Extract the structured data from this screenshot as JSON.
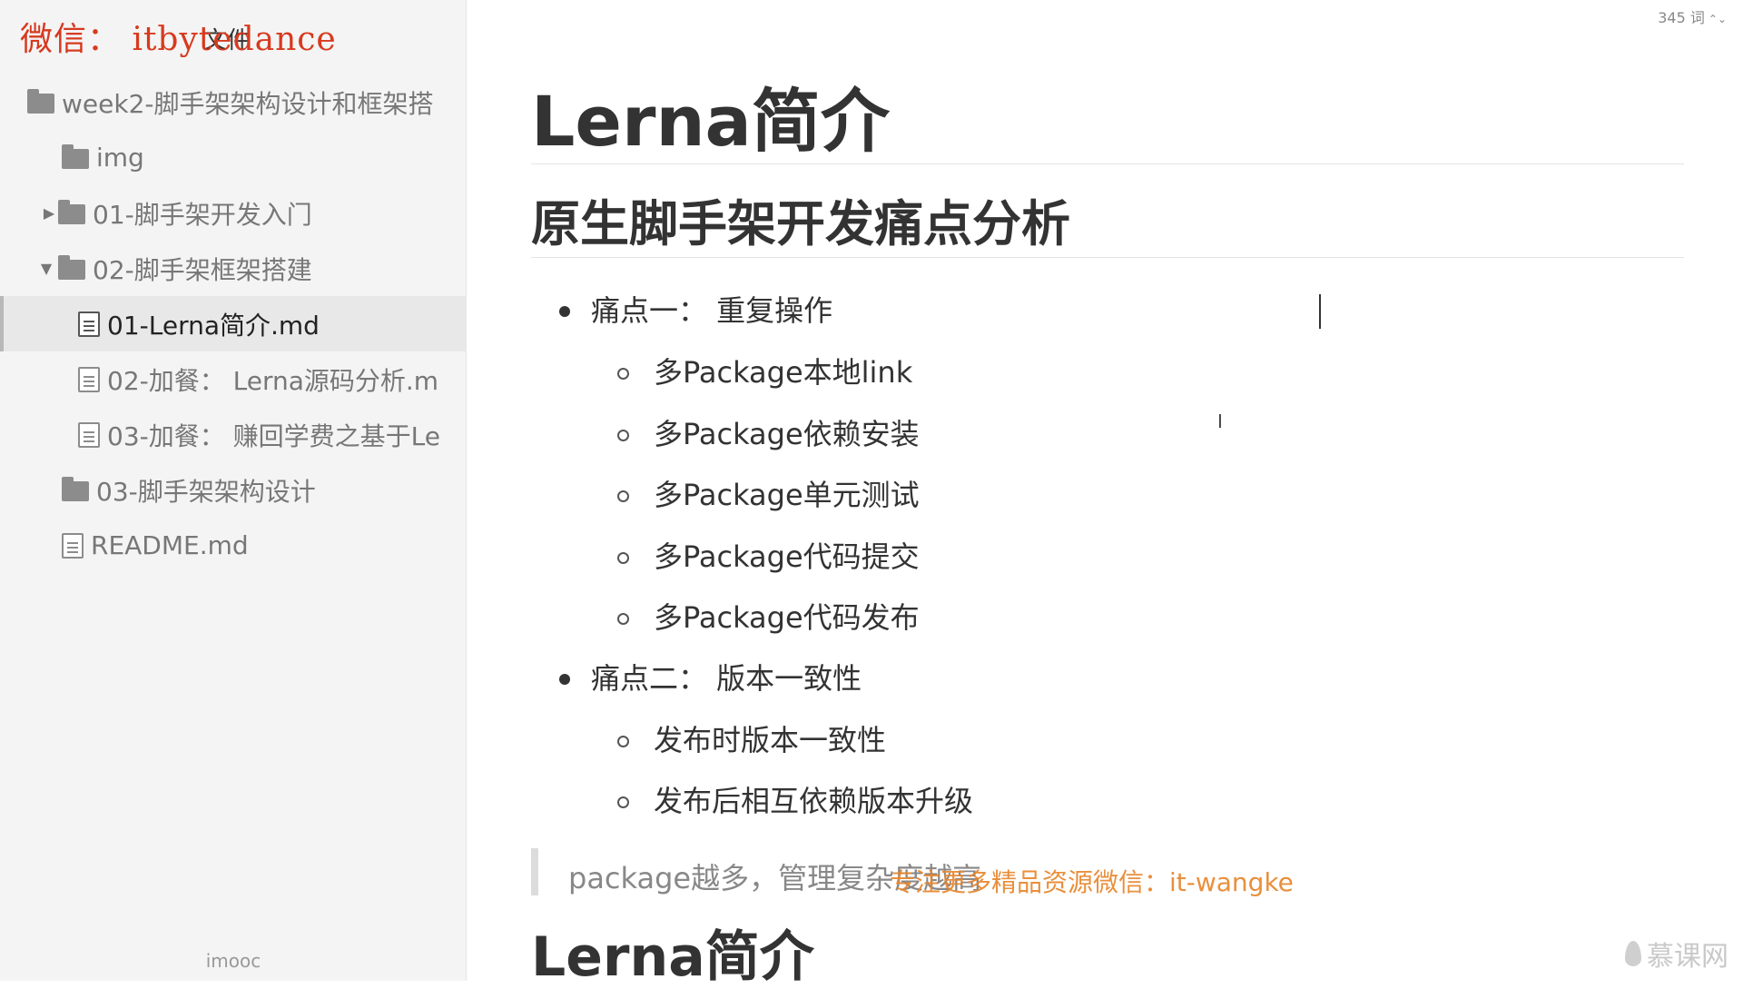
{
  "watermark_top_left": "微信： itbytedance",
  "sidebar": {
    "title": "文件",
    "items": [
      {
        "label": "week2-脚手架架构设计和框架搭",
        "type": "folder",
        "expander": "",
        "active": false
      },
      {
        "label": "img",
        "type": "folder",
        "expander": "",
        "active": false
      },
      {
        "label": "01-脚手架开发入门",
        "type": "folder",
        "expander": "▶",
        "active": false
      },
      {
        "label": "02-脚手架框架搭建",
        "type": "folder",
        "expander": "▼",
        "active": false
      },
      {
        "label": "01-Lerna简介.md",
        "type": "file",
        "expander": "",
        "active": true
      },
      {
        "label": "02-加餐：  Lerna源码分析.m",
        "type": "file",
        "expander": "",
        "active": false
      },
      {
        "label": "03-加餐：  赚回学费之基于Le",
        "type": "file",
        "expander": "",
        "active": false
      },
      {
        "label": "03-脚手架架构设计",
        "type": "folder",
        "expander": "",
        "active": false
      },
      {
        "label": "README.md",
        "type": "file",
        "expander": "",
        "active": false
      }
    ],
    "footer": "imooc"
  },
  "editor": {
    "word_count": "345 词",
    "h1": "Lerna简介",
    "h2": "原生脚手架开发痛点分析",
    "list": [
      {
        "text": "痛点一：  重复操作",
        "level": 1
      },
      {
        "text": "多Package本地link",
        "level": 2
      },
      {
        "text": "多Package依赖安装",
        "level": 2
      },
      {
        "text": "多Package单元测试",
        "level": 2
      },
      {
        "text": "多Package代码提交",
        "level": 2
      },
      {
        "text": "多Package代码发布",
        "level": 2
      },
      {
        "text": "痛点二：  版本一致性",
        "level": 1
      },
      {
        "text": "发布时版本一致性",
        "level": 2
      },
      {
        "text": "发布后相互依赖版本升级",
        "level": 2
      }
    ],
    "blockquote": "package越多，管理复杂度越高",
    "overlay_watermark": "专注更多精品资源微信：it-wangke",
    "h1_bottom": "Lerna简介"
  },
  "brand": "慕课网"
}
